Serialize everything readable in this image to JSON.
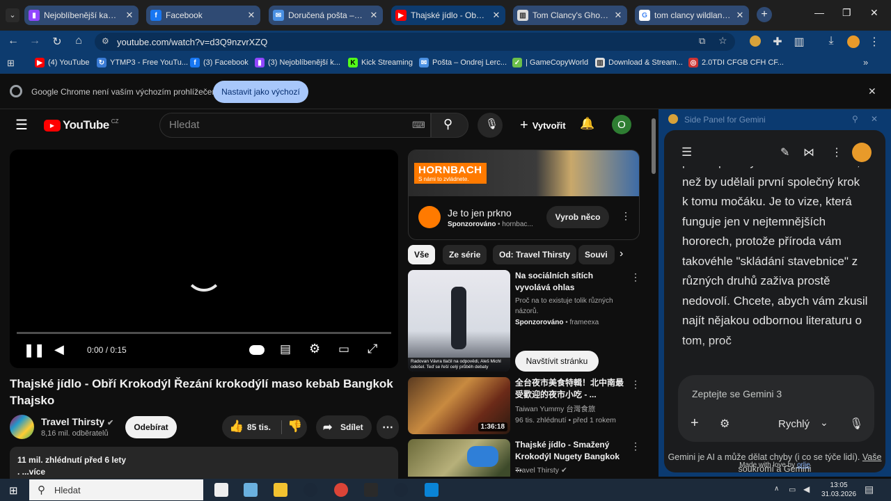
{
  "browser": {
    "tabs": [
      {
        "title": "Nejoblíbenější kanály - Twitch",
        "icon": "twitch-icon"
      },
      {
        "title": "Facebook",
        "icon": "facebook-icon"
      },
      {
        "title": "Doručená pošta – Ondrej",
        "icon": "mail-icon"
      },
      {
        "title": "Thajské jídlo - Obří Krokodýl",
        "icon": "youtube-icon"
      },
      {
        "title": "Tom Clancy's Ghost Recon",
        "icon": "store-icon"
      },
      {
        "title": "tom clancy wildlands - Hledat",
        "icon": "google-icon"
      }
    ],
    "url": "youtube.com/watch?v=d3Q9nzvrXZQ",
    "bookmarks": [
      {
        "label": "(4) YouTube"
      },
      {
        "label": "YTMP3 - Free YouTu..."
      },
      {
        "label": "(3) Facebook"
      },
      {
        "label": "(3) Nejoblíbenější k..."
      },
      {
        "label": "Kick Streaming"
      },
      {
        "label": "Pošta – Ondrej Lerc..."
      },
      {
        "label": "| GameCopyWorld"
      },
      {
        "label": "Download & Stream..."
      },
      {
        "label": "2.0TDI CFGB CFH CF..."
      }
    ],
    "infobar": {
      "message": "Google Chrome není vaším výchozím prohlížečem",
      "button": "Nastavit jako výchozí"
    }
  },
  "youtube": {
    "logo": "YouTube",
    "region": "CZ",
    "search_placeholder": "Hledat",
    "create": "Vytvořit",
    "avatar_letter": "O",
    "player": {
      "time": "0:00 / 0:15",
      "progress": 0
    },
    "title": "Thajské jídlo - Obří Krokodýl Řezání krokodýlí maso kebab Bangkok Thajsko",
    "channel": {
      "name": "Travel Thirsty",
      "subs": "8,16 mil. odběratelů",
      "subscribe": "Odebírat"
    },
    "likes": "85 tis.",
    "share": "Sdílet",
    "description": {
      "stats": "11 mil. zhlédnutí  před 6 lety",
      "more": ". ...více"
    },
    "ad": {
      "brand": "HORNBACH",
      "slogan": "S námi to zvládnete.",
      "headline": "Je to jen prkno",
      "sponsored": "Sponzorováno",
      "domain": "hornbac...",
      "cta": "Vyrob něco"
    },
    "chips": [
      "Vše",
      "Ze série",
      "Od: Travel Thirsty",
      "Souvi"
    ],
    "related": [
      {
        "title": "Na sociálních sítích vyvolává ohlas",
        "line2": "Proč na to existuje tolik různých názorů.",
        "line3": "Sponzorováno",
        "line3b": "frameexa",
        "cta": "Navštívit stránku",
        "caption": "Radovan Vávra tlačil na odpovědi, Aleš Michl odešel. Teď se řeší celý průběh debaty"
      },
      {
        "title": "全台夜市美食特輯！北中南最受歡迎的夜市小吃 - ...",
        "line2": "Taiwan Yummy 台灣食旅",
        "line3": "96 tis. zhlédnutí • před 1 rokem",
        "duration": "1:36:18"
      },
      {
        "title": "Thajské jídlo - Smažený Krokodýl Nugety Bangkok ...",
        "line2": "Travel Thirsty"
      }
    ]
  },
  "gemini": {
    "header": "Side Panel for Gemini",
    "text": "prostě praskly kosti v nohách dřív, než by udělali první společný krok k tomu močáku. Je to vize, která funguje jen v nejtemnějších hororech, protože příroda vám takovéhle \"skládání stavebnice\" z různých druhů zaživa prostě nedovolí. Chcete, abych vám zkusil najít nějakou odbornou literaturu o tom, proč",
    "input_placeholder": "Zeptejte se Gemini 3",
    "mode": "Rychlý",
    "disclaimer": "Gemini je AI a může dělat chyby (i co se týče lidí).",
    "privacy_link": "Vaše soukromí a Gemini",
    "made_with": "Made with love by",
    "made_by": "orlie"
  },
  "taskbar": {
    "search": "Hledat",
    "time": "13:05",
    "date": "31.03.2026"
  },
  "colors": {
    "tab_bg": "#2f4a73",
    "chrome_bar": "#0d3b6e",
    "yt_red": "#ff0000",
    "accent_blue": "#a8c7fa"
  }
}
